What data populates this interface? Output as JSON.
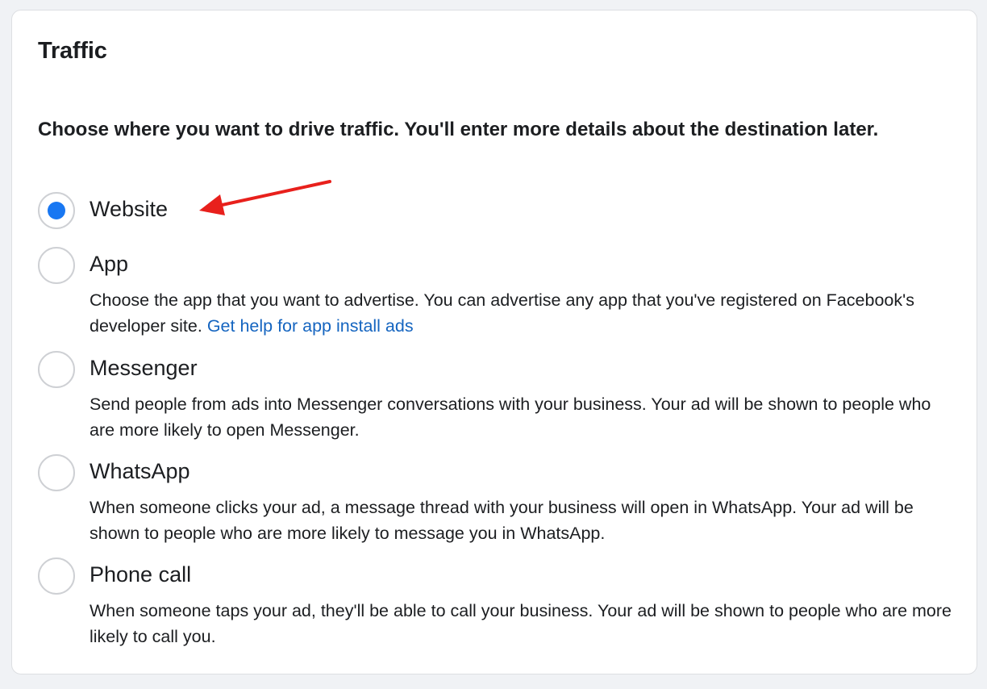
{
  "panel": {
    "title": "Traffic",
    "prompt": "Choose where you want to drive traffic. You'll enter more details about the destination later."
  },
  "options": [
    {
      "label": "Website",
      "selected": true,
      "description": ""
    },
    {
      "label": "App",
      "selected": false,
      "description": "Choose the app that you want to advertise. You can advertise any app that you've registered on Facebook's developer site.",
      "link": "Get help for app install ads"
    },
    {
      "label": "Messenger",
      "selected": false,
      "description": "Send people from ads into Messenger conversations with your business. Your ad will be shown to people who are more likely to open Messenger."
    },
    {
      "label": "WhatsApp",
      "selected": false,
      "description": "When someone clicks your ad, a message thread with your business will open in WhatsApp. Your ad will be shown to people who are more likely to message you in WhatsApp."
    },
    {
      "label": "Phone call",
      "selected": false,
      "description": "When someone taps your ad, they'll be able to call your business. Your ad will be shown to people who are more likely to call you."
    }
  ],
  "colors": {
    "accent": "#1877f2",
    "link": "#1565c0",
    "annotation_arrow": "#e8201c",
    "radio_border": "#ced0d4"
  },
  "annotation": {
    "icon": "red-arrow-icon",
    "points_to": "Website"
  }
}
